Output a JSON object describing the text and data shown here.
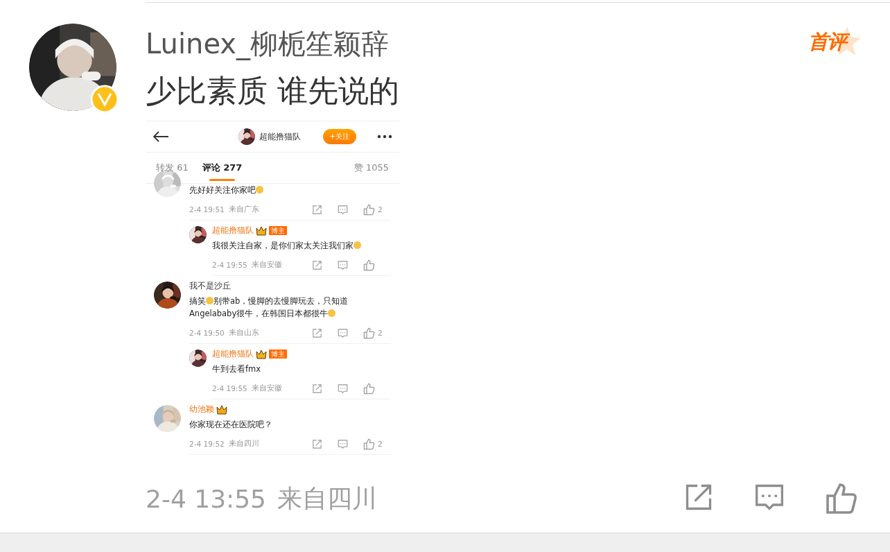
{
  "post": {
    "author": "Luinex_柳栀笙颖辞",
    "verified": true,
    "badge": "首评",
    "text": "少比素质 谁先说的",
    "time": "2-4 13:55",
    "location": "来自四川"
  },
  "screenshot": {
    "header": {
      "name": "超能撸猫队",
      "follow": "+关注"
    },
    "tabs": [
      {
        "label": "转发 61",
        "selected": false
      },
      {
        "label": "评论 277",
        "selected": true
      },
      {
        "label": "赞 1055",
        "selected": false
      }
    ],
    "comments": [
      {
        "kind": "top",
        "parts": [
          {
            "kind": "text",
            "text": "先好好关注你家吧"
          },
          {
            "kind": "emoji"
          }
        ],
        "time": "2-4 19:51",
        "location": "来自广东",
        "likes": "2"
      },
      {
        "kind": "reply",
        "author": "超能撸猫队",
        "highlight": true,
        "crown": true,
        "badge": "博主",
        "parts": [
          {
            "kind": "text",
            "text": "我很关注自家，是你们家太关注我们家"
          },
          {
            "kind": "emoji"
          }
        ],
        "time": "2-4 19:55",
        "location": "来自安徽"
      },
      {
        "kind": "top",
        "author": "我不是沙丘",
        "highlight": false,
        "parts": [
          {
            "kind": "text",
            "text": "搞笑"
          },
          {
            "kind": "emoji"
          },
          {
            "kind": "text",
            "text": "别带ab，慢脚的去慢脚玩去，只知道Angelababy很牛，在韩国日本都很牛"
          },
          {
            "kind": "emoji"
          }
        ],
        "time": "2-4 19:50",
        "location": "来自山东",
        "likes": "2"
      },
      {
        "kind": "reply",
        "author": "超能撸猫队",
        "highlight": true,
        "crown": true,
        "badge": "博主",
        "parts": [
          {
            "kind": "text",
            "text": "牛到去看fmx"
          }
        ],
        "time": "2-4 19:55",
        "location": "来自安徽"
      },
      {
        "kind": "top",
        "author": "幼池颖",
        "highlight": true,
        "crown": true,
        "parts": [
          {
            "kind": "text",
            "text": "你家现在还在医院吧？"
          }
        ],
        "time": "2-4 19:52",
        "location": "来自四川",
        "likes": "2"
      }
    ]
  }
}
